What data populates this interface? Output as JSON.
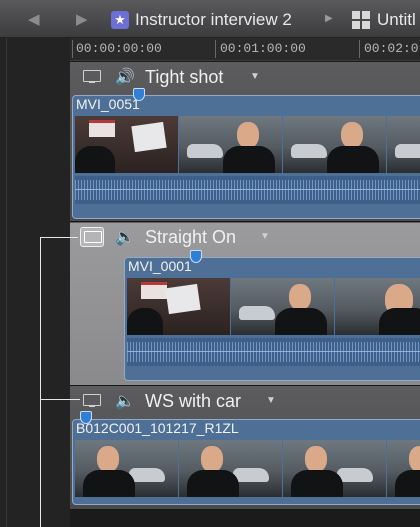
{
  "header": {
    "project_title": "Instructor interview 2",
    "project2_title": "Untitl",
    "project_icon": "star-icon",
    "back_icon": "back-arrow-icon",
    "forward_icon": "forward-arrow-icon"
  },
  "ruler": {
    "timecodes": [
      "00:00:00:00",
      "00:01:00:00",
      "00:02:0"
    ]
  },
  "angles": [
    {
      "name": "Tight shot",
      "video_active": false,
      "audio_active": true,
      "clip_name": "MVI_0051"
    },
    {
      "name": "Straight On",
      "video_active": true,
      "audio_active": false,
      "clip_name": "MVI_0001"
    },
    {
      "name": "WS with car",
      "video_active": false,
      "audio_active": false,
      "clip_name": "B012C001_101217_R1ZL"
    }
  ],
  "colors": {
    "clip_blue": "#4e6f96",
    "marker_blue": "#2f7fd6",
    "active_lane": "#9b9b9d"
  }
}
